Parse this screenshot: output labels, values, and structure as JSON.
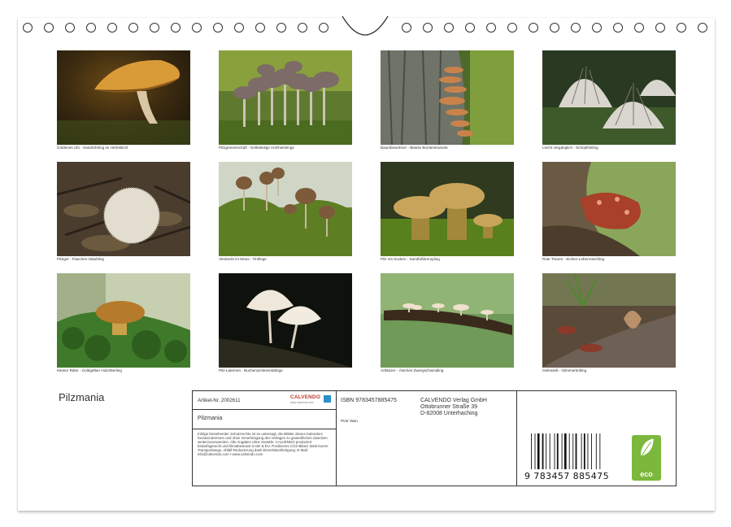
{
  "calendar": {
    "title": "Pilzmania",
    "photos": [
      {
        "caption": "Goldenes Ufo - Sandröhrling im Herbstlicht"
      },
      {
        "caption": "Pilzgemeinschaft - Gelbstielige Holzhelmlinge"
      },
      {
        "caption": "Baumbewohner - Blasse Borstentramete"
      },
      {
        "caption": "Leicht vergänglich - Schopftintling"
      },
      {
        "caption": "Pilzigel - Flaschen-Stäubling"
      },
      {
        "caption": "Versteckt im Moos - Tintlinge"
      },
      {
        "caption": "Pilz mit Socken - Samtfußkrempling"
      },
      {
        "caption": "Rote Tränen - Eichen-Leberreischling"
      },
      {
        "caption": "Kleiner Ritter - Goldgelber Holzritterling"
      },
      {
        "caption": "Pilz-Laternen - Buchenschleimrüblinge"
      },
      {
        "caption": "Arttänzer - Ästchen-Zwergschwindling"
      },
      {
        "caption": "Gefesselt - Glimmertintling"
      }
    ]
  },
  "info": {
    "article_no": "Artikel-Nr. 2002611",
    "product_title": "Pilzmania",
    "legal_text": "Infolge bestehender Schutzrechte ist es untersagt, die Blätter dieses Kalenders herauszutrennen und ohne Genehmigung des Verlages zu gewerblichen Zwecken weiterzuverwenden. Alle Angaben ohne Gewähr. CALVENDO produziert bedarfsgerecht und klimabewusst in DE & EU. Positiveres CO2-Bilanz dank kurzer Transportwege, Abfall-Reduzierung dank Einzelstückfertigung. E-Mail: info@calvendo.com • www.calvendo.com",
    "logo_word": "CALVENDO",
    "logo_sub": "www.calvendo.com",
    "isbn": "ISBN 9783457885475",
    "author": "Piotr Wan",
    "publisher_name": "CALVENDO Verlag GmbH",
    "publisher_street": "Ottobrunner Straße 39",
    "publisher_city": "D-82008 Unterhaching",
    "barcode_number": "9 783457 885475",
    "eco_label": "eco"
  },
  "colors": {
    "eco_green": "#7cb83b",
    "logo_red": "#c0392b",
    "logo_blue": "#2c8fc9"
  }
}
